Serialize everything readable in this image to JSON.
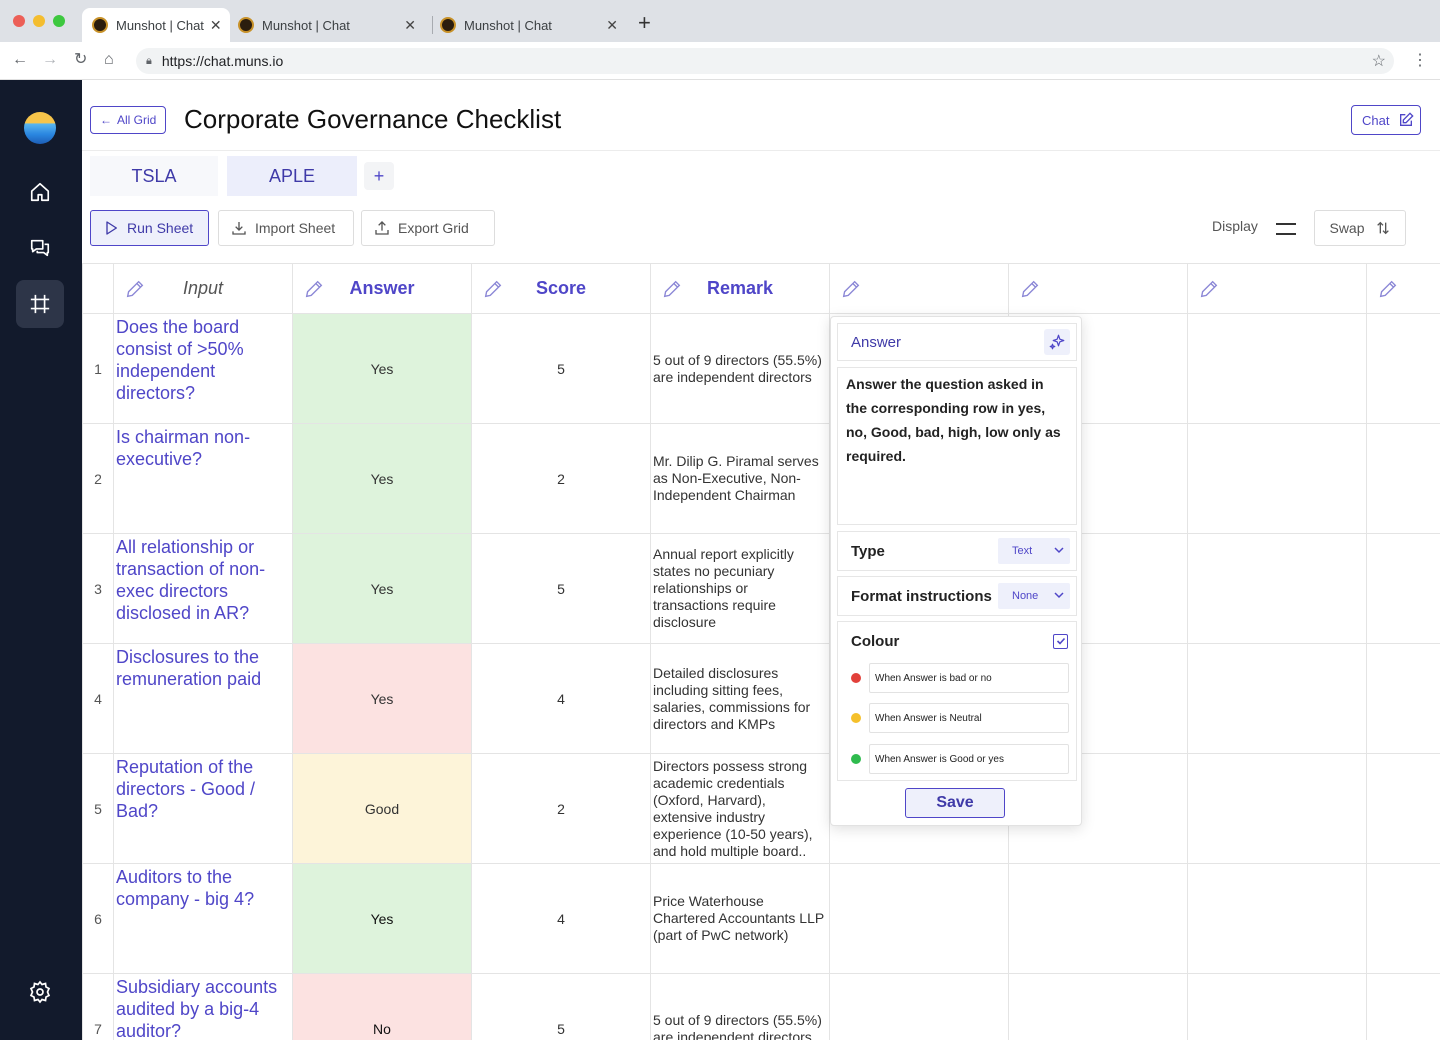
{
  "browser": {
    "tabs": [
      {
        "title": "Munshot | Chat",
        "active": true
      },
      {
        "title": "Munshot | Chat",
        "active": false
      },
      {
        "title": "Munshot | Chat",
        "active": false
      }
    ],
    "url": "https://chat.muns.io"
  },
  "sidebar": {
    "items": [
      {
        "icon": "home-icon"
      },
      {
        "icon": "chat-bubbles-icon"
      },
      {
        "icon": "grid-frame-icon",
        "active": true
      },
      {
        "icon": "settings-gear-icon"
      }
    ]
  },
  "header": {
    "back_label": "All Grid",
    "title": "Corporate Governance Checklist",
    "chat_label": "Chat"
  },
  "sheet_tabs": [
    "TSLA",
    "APLE"
  ],
  "toolbar": {
    "run_label": "Run Sheet",
    "import_label": "Import Sheet",
    "export_label": "Export Grid",
    "display_label": "Display",
    "swap_label": "Swap"
  },
  "grid": {
    "columns": [
      "Input",
      "Answer",
      "Score",
      "Remark",
      "",
      "",
      "",
      ""
    ],
    "rows": [
      {
        "num": "1",
        "input": "Does the board consist of >50% independent directors?",
        "answer": "Yes",
        "answer_color": "green",
        "score": "5",
        "remark": "5 out of 9 directors (55.5%) are independent directors"
      },
      {
        "num": "2",
        "input": "Is chairman non-executive?",
        "answer": "Yes",
        "answer_color": "green",
        "score": "2",
        "remark": "Mr. Dilip G. Piramal serves as Non-Executive, Non-Independent Chairman"
      },
      {
        "num": "3",
        "input": "All relationship or transaction of non-exec directors disclosed in AR?",
        "answer": "Yes",
        "answer_color": "green",
        "score": "5",
        "remark": "Annual report explicitly states no pecuniary relationships or transactions require disclosure"
      },
      {
        "num": "4",
        "input": "Disclosures to the remuneration paid",
        "answer": "Yes",
        "answer_color": "red",
        "score": "4",
        "remark": "Detailed disclosures including sitting fees, salaries, commissions for directors and KMPs"
      },
      {
        "num": "5",
        "input": "Reputation of the directors - Good / Bad?",
        "answer": "Good",
        "answer_color": "yellow",
        "score": "2",
        "remark": "Directors possess strong academic credentials (Oxford, Harvard), extensive industry experience (10-50 years), and hold multiple board.."
      },
      {
        "num": "6",
        "input": "Auditors to the company - big 4?",
        "answer": "Yes",
        "answer_color": "green",
        "score": "4",
        "remark": "Price Waterhouse Chartered Accountants LLP (part of PwC network)"
      },
      {
        "num": "7",
        "input": "Subsidiary accounts audited by a big-4 auditor?",
        "answer": "No",
        "answer_color": "red",
        "score": "5",
        "remark": "5 out of 9 directors (55.5%) are independent directors"
      }
    ]
  },
  "column_editor": {
    "title": "Answer",
    "prompt": "Answer the question asked in the corresponding row in yes, no, Good, bad, high, low only as required.",
    "type_label": "Type",
    "type_value": "Text",
    "format_label": "Format instructions",
    "format_value": "None",
    "colour_label": "Colour",
    "colour_checked": true,
    "rules": [
      {
        "color": "#e2403a",
        "text": "When Answer is bad or no"
      },
      {
        "color": "#f5c02b",
        "text": "When Answer is Neutral"
      },
      {
        "color": "#2fbb4e",
        "text": "When Answer is Good or yes"
      }
    ],
    "save_label": "Save"
  }
}
